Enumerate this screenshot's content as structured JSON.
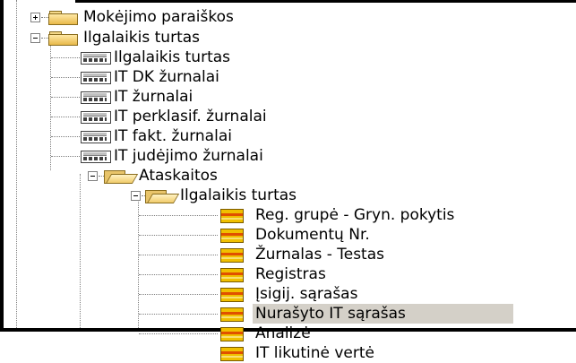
{
  "tree": {
    "items": [
      {
        "label": "Mokėjimo paraiškos",
        "icon": "folder-closed-icon",
        "expander": "plus"
      },
      {
        "label": "Ilgalaikis turtas",
        "icon": "folder-closed-icon",
        "expander": "minus"
      },
      {
        "label": "Ilgalaikis turtas",
        "icon": "journal-icon"
      },
      {
        "label": "IT DK žurnalai",
        "icon": "journal-icon"
      },
      {
        "label": "IT žurnalai",
        "icon": "journal-icon"
      },
      {
        "label": "IT perklasif. žurnalai",
        "icon": "journal-icon"
      },
      {
        "label": "IT fakt. žurnalai",
        "icon": "journal-icon"
      },
      {
        "label": "IT judėjimo žurnalai",
        "icon": "journal-icon"
      },
      {
        "label": "Ataskaitos",
        "icon": "folder-open-icon",
        "expander": "minus"
      },
      {
        "label": "Ilgalaikis turtas",
        "icon": "folder-open-icon",
        "expander": "minus"
      },
      {
        "label": "Reg. grupė - Gryn. pokytis",
        "icon": "report-icon"
      },
      {
        "label": "Dokumentų Nr.",
        "icon": "report-icon"
      },
      {
        "label": "Žurnalas - Testas",
        "icon": "report-icon"
      },
      {
        "label": "Registras",
        "icon": "report-icon"
      },
      {
        "label": "Įsigij. sąrašas",
        "icon": "report-icon"
      },
      {
        "label": "Nurašyto IT sąrašas",
        "icon": "report-icon",
        "selected": true
      },
      {
        "label": "Analizė",
        "icon": "report-icon"
      },
      {
        "label": "IT likutinė vertė",
        "icon": "report-icon"
      }
    ]
  },
  "colors": {
    "selection": "#d4d0c8",
    "tree_lines": "#808080"
  }
}
